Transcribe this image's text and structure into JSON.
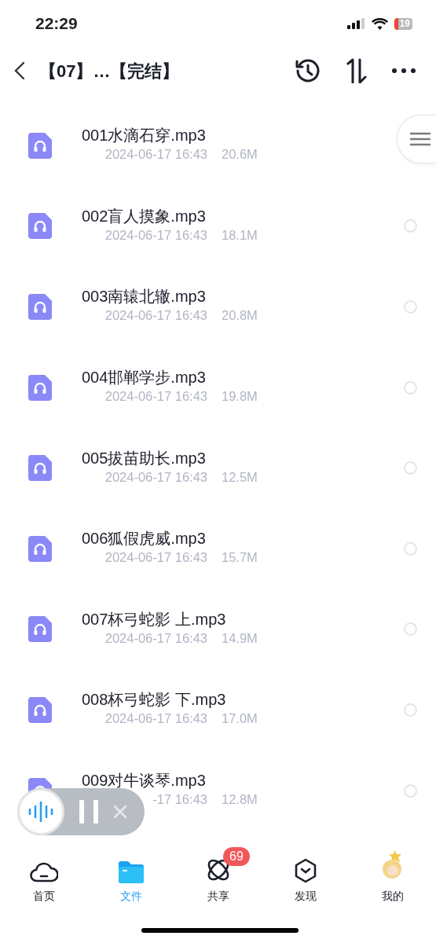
{
  "status_bar": {
    "time": "22:29",
    "battery": "19"
  },
  "header": {
    "title": "【07】…【完结】"
  },
  "files": [
    {
      "name": "001水滴石穿.mp3",
      "date": "2024-06-17 16:43",
      "size": "20.6M"
    },
    {
      "name": "002盲人摸象.mp3",
      "date": "2024-06-17 16:43",
      "size": "18.1M",
      "selected": false
    },
    {
      "name": "003南辕北辙.mp3",
      "date": "2024-06-17 16:43",
      "size": "20.8M",
      "selected": false
    },
    {
      "name": "004邯郸学步.mp3",
      "date": "2024-06-17 16:43",
      "size": "19.8M",
      "selected": false
    },
    {
      "name": "005拔苗助长.mp3",
      "date": "2024-06-17 16:43",
      "size": "12.5M",
      "selected": false
    },
    {
      "name": "006狐假虎威.mp3",
      "date": "2024-06-17 16:43",
      "size": "15.7M",
      "selected": false
    },
    {
      "name": "007杯弓蛇影 上.mp3",
      "date": "2024-06-17 16:43",
      "size": "14.9M",
      "selected": false
    },
    {
      "name": "008杯弓蛇影 下.mp3",
      "date": "2024-06-17 16:43",
      "size": "17.0M",
      "selected": false
    },
    {
      "name": "009对牛谈琴.mp3",
      "date": "-17 16:43",
      "size": "12.8M",
      "selected": false
    }
  ],
  "tab_bar": [
    {
      "kind": "home",
      "label": "首页",
      "selected": false
    },
    {
      "kind": "files",
      "label": "文件",
      "selected": true
    },
    {
      "kind": "share",
      "label": "共享",
      "selected": false,
      "badge": "69"
    },
    {
      "kind": "discover",
      "label": "发现",
      "selected": false
    },
    {
      "kind": "me",
      "label": "我的",
      "selected": false
    }
  ]
}
